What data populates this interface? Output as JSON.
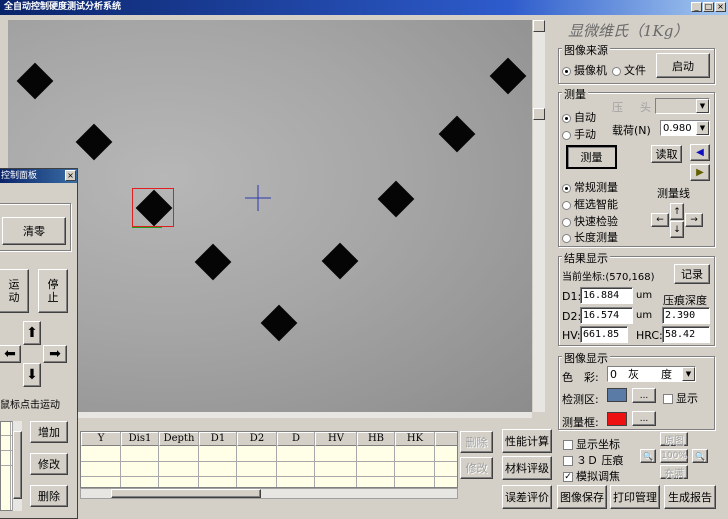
{
  "window": {
    "title": "全自动控制硬度测试分析系统",
    "min_label": "_",
    "max_label": "□",
    "close_label": "×"
  },
  "brand": "显微维氏（1Kg）",
  "image_source": {
    "title": "图像来源",
    "camera": "摄像机",
    "file": "文件",
    "start": "启动",
    "selected": "camera"
  },
  "measure": {
    "title": "测量",
    "auto": "自动",
    "manual": "手动",
    "selected_mode": "auto",
    "press": "压",
    "fire": "头",
    "load_label": "载荷(N)",
    "load_value": "0.980",
    "measure_button": "测量",
    "read_button": "读取",
    "left_icon": "◀",
    "right_icon": "▶",
    "modes": [
      "常规测量",
      "框选智能",
      "快速检验",
      "长度测量"
    ],
    "selected_measure_mode": 0,
    "line_label": "测量线",
    "arrows": {
      "up": "↑",
      "down": "↓",
      "left": "←",
      "right": "→"
    }
  },
  "results": {
    "title": "结果显示",
    "coord_label": "当前坐标:",
    "coord_value": "(570,168)",
    "record": "记录",
    "d1_label": "D1:",
    "d1_value": "16.884",
    "d1_unit": "um",
    "depth_label": "压痕深度",
    "d2_label": "D2:",
    "d2_value": "16.574",
    "d2_unit": "um",
    "depth_value": "2.390",
    "hv_label": "HV:",
    "hv_value": "661.85",
    "hrc_label": "HRC:",
    "hrc_value": "58.42"
  },
  "display": {
    "title": "图像显示",
    "color_label": "色　彩:",
    "color_value": "0　灰　　度",
    "detect_label": "检测区:",
    "detect_color": "#5b7ba7",
    "ellipsis": "...",
    "show_label": "显示",
    "frame_label": "测量框:",
    "frame_color": "#ee1111"
  },
  "options": {
    "show_coord": "显示坐标",
    "pressure_3d": "３Ｄ 压痕",
    "simulate_focus": "模拟调焦",
    "simulate_checked": true
  },
  "zoom": {
    "restore": "原图",
    "zoom_value": "100%",
    "fill": "充满"
  },
  "table": {
    "columns": [
      "Y",
      "Dis1",
      "Depth",
      "D1",
      "D2",
      "D",
      "HV",
      "HB",
      "HK"
    ]
  },
  "table_buttons": {
    "delete": "删除",
    "modify": "修改"
  },
  "analysis_buttons": {
    "performance": "性能计算",
    "material": "材料评级",
    "error": "误差评价"
  },
  "bottom_buttons": {
    "save_image": "图像保存",
    "print": "打印管理",
    "report": "生成报告"
  },
  "control_panel": {
    "title": "控制面板",
    "clear": "清零",
    "run": "运\n动",
    "stop": "停\n止",
    "arrows": {
      "up": "⬆",
      "down": "⬇",
      "left": "⬅",
      "right": "➡"
    },
    "hint": "鼠标点击运动",
    "add": "增加",
    "modify": "修改",
    "delete": "删除"
  },
  "colors": {
    "titlebar": "#0a246a",
    "panel_bg": "#d4d0c8",
    "table_bg": "#ffffe8",
    "measure_box": "#e02020",
    "crosshair": "#2a3ab0"
  }
}
